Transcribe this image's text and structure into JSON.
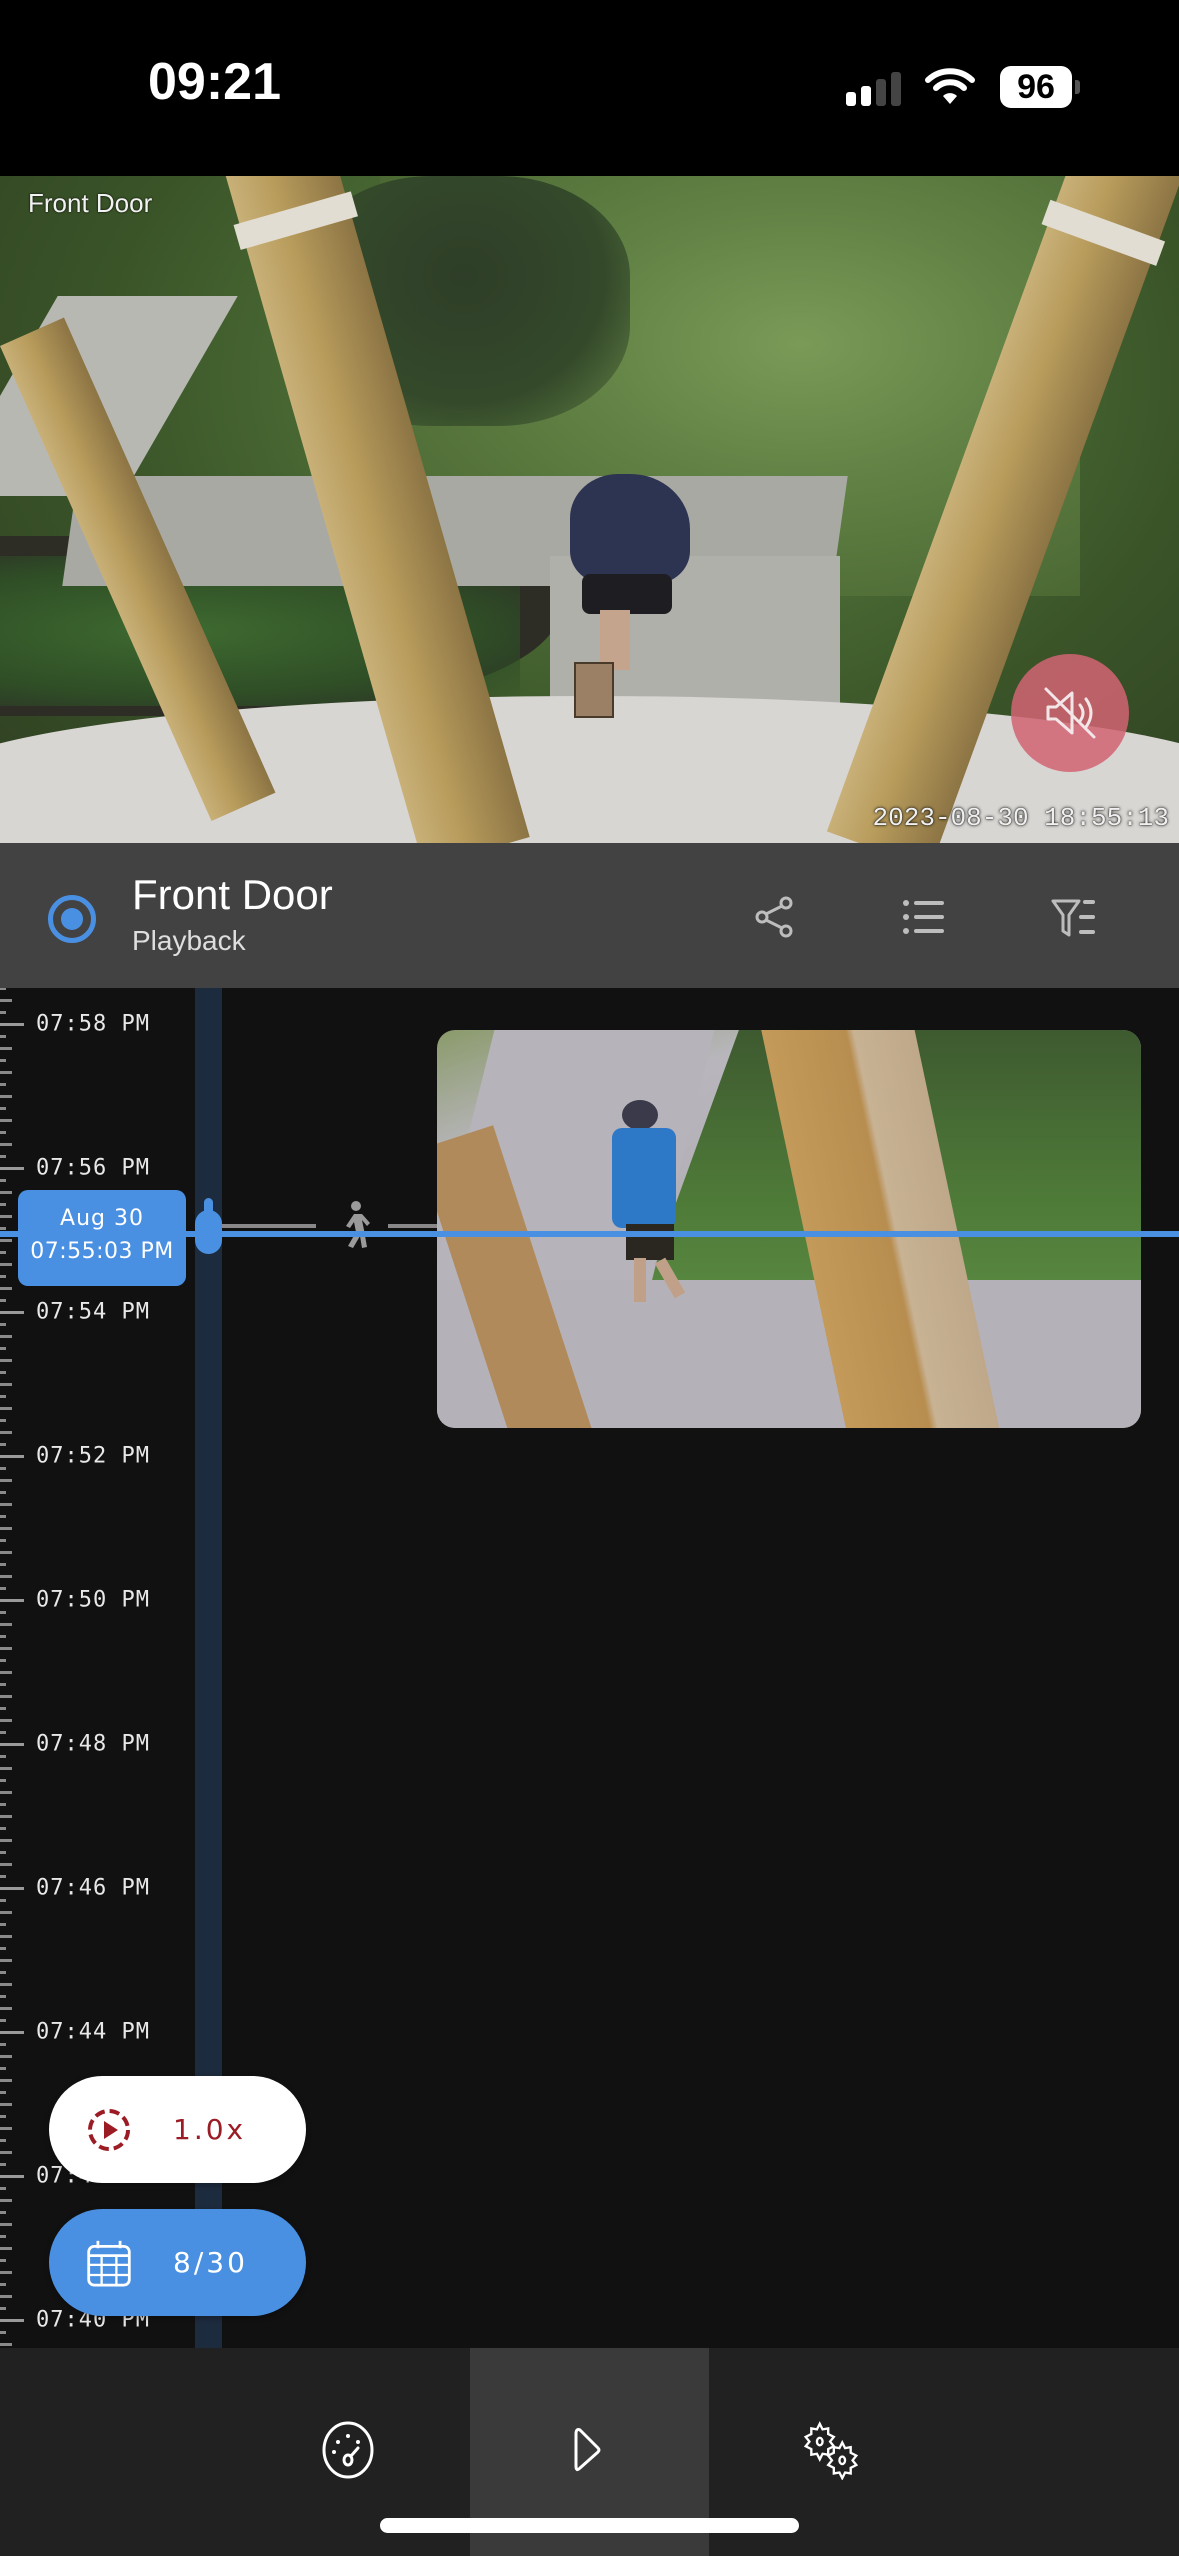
{
  "status_bar": {
    "time": "09:21",
    "signal_bars_active": 2,
    "signal_bars_total": 4,
    "wifi": "wifi-icon",
    "battery_percent": "96"
  },
  "camera_feed": {
    "overlay_label": "Front Door",
    "timestamp": "2023-08-30 18:55:13",
    "mute_button": {
      "icon": "speaker-muted-icon",
      "color": "#d26473"
    }
  },
  "header": {
    "title": "Front Door",
    "subtitle": "Playback",
    "indicator_color": "#4a90e2",
    "actions": [
      {
        "name": "share",
        "icon": "share-icon"
      },
      {
        "name": "list",
        "icon": "list-icon"
      },
      {
        "name": "filter",
        "icon": "filter-icon"
      }
    ]
  },
  "timeline": {
    "tick_labels": [
      "07:58 PM",
      "07:56 PM",
      "07:54 PM",
      "07:52 PM",
      "07:50 PM",
      "07:48 PM",
      "07:46 PM",
      "07:44 PM",
      "07:42 PM",
      "07:40 PM"
    ],
    "current": {
      "date": "Aug 30",
      "time": "07:55:03 PM"
    },
    "events": [
      {
        "type": "motion",
        "icon": "person-walking-icon"
      }
    ],
    "accent_color": "#4a90e2"
  },
  "controls": {
    "speed": {
      "label": "1.0x",
      "icon": "playback-speed-icon",
      "color": "#9b1c24"
    },
    "date": {
      "label": "8/30",
      "icon": "calendar-icon",
      "color": "#4a90e2"
    }
  },
  "bottom_nav": {
    "tabs": [
      {
        "name": "dashboard",
        "icon": "dashboard-gauge-icon",
        "active": false
      },
      {
        "name": "playback",
        "icon": "play-icon",
        "active": true
      },
      {
        "name": "settings",
        "icon": "settings-gears-icon",
        "active": false
      }
    ]
  }
}
